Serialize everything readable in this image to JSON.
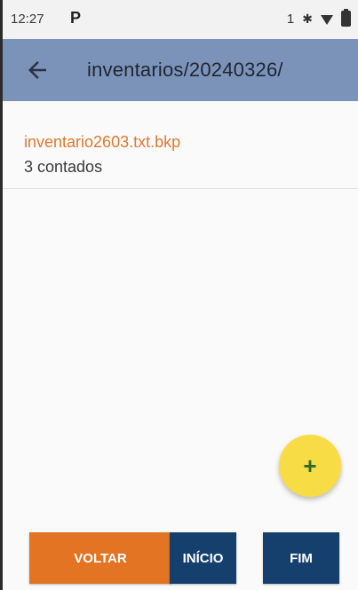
{
  "status_bar": {
    "time": "12:27",
    "app_indicator": "P",
    "sim_slot": "1",
    "icons": [
      "bluetooth-icon",
      "wifi-icon",
      "battery-icon"
    ]
  },
  "toolbar": {
    "title": "inventarios/20240326/",
    "back_icon": "arrow-left-icon",
    "background": "#7c93b9"
  },
  "files": [
    {
      "name": "inventario2603.txt.bkp",
      "subtitle": "3 contados"
    }
  ],
  "fab": {
    "label": "+",
    "color": "#f8dc45"
  },
  "buttons": {
    "voltar": "VOLTAR",
    "inicio": "INÍCIO",
    "fim": "FIM"
  },
  "colors": {
    "accent_orange": "#e27424",
    "primary_navy": "#153f6c",
    "file_name": "#e0782e"
  }
}
